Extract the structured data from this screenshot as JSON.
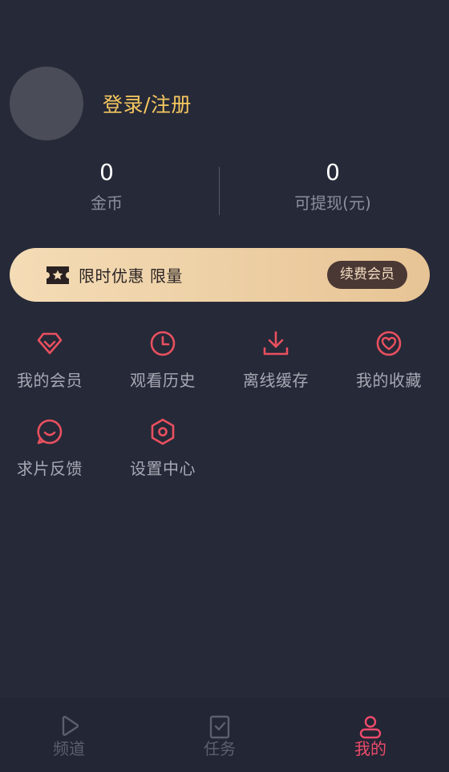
{
  "profile": {
    "login_label": "登录/注册"
  },
  "stats": {
    "coins_value": "0",
    "coins_label": "金币",
    "withdraw_value": "0",
    "withdraw_label": "可提现(元)"
  },
  "vip_banner": {
    "promo_text": "限时优惠 限量",
    "renew_label": "续费会员"
  },
  "menu": {
    "items": [
      {
        "label": "我的会员",
        "icon": "diamond-icon"
      },
      {
        "label": "观看历史",
        "icon": "clock-icon"
      },
      {
        "label": "离线缓存",
        "icon": "download-icon"
      },
      {
        "label": "我的收藏",
        "icon": "heart-icon"
      },
      {
        "label": "求片反馈",
        "icon": "chat-smile-icon"
      },
      {
        "label": "设置中心",
        "icon": "settings-hexagon-icon"
      }
    ]
  },
  "tabbar": {
    "tabs": [
      {
        "label": "频道",
        "icon": "play-icon"
      },
      {
        "label": "任务",
        "icon": "task-check-icon"
      },
      {
        "label": "我的",
        "icon": "user-icon",
        "active": true
      }
    ]
  },
  "colors": {
    "background": "#262938",
    "accent": "#ee4a6c",
    "icon_red": "#e9505f",
    "login_yellow": "#f6c85f",
    "banner_gold": "#f4dcb6"
  }
}
